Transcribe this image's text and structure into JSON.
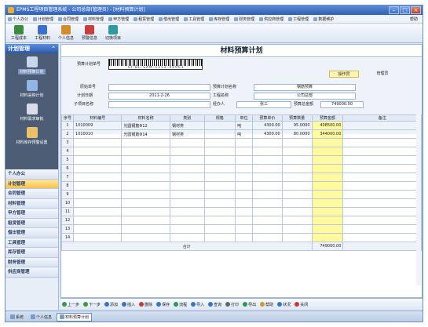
{
  "window": {
    "title": "EPMS工程项目管理系统 - 公司总部(管理员) - [材料预算计划]"
  },
  "menu": [
    "个人办公",
    "计划管理",
    "合同管理",
    "材料管理",
    "甲方管理",
    "租赁管理",
    "借出管理",
    "工具管理",
    "库存管理",
    "财务管理",
    "供应商管理",
    "工程管理",
    "数据维护"
  ],
  "menu_help": "帮助",
  "toolbar": [
    {
      "label": "工程成本",
      "color": "#3f8a3f"
    },
    {
      "label": "工程材料",
      "color": "#3c6fc7"
    },
    {
      "label": "个人信息",
      "color": "#d18d2a"
    },
    {
      "label": "预警信息",
      "color": "#c74040"
    },
    {
      "label": "切换项目",
      "color": "#2f9a9a"
    }
  ],
  "sidebar": {
    "header": "计划管理",
    "icons": [
      {
        "label": "材料预算计划",
        "color": "#c8d6ec"
      },
      {
        "label": "材料采购计划",
        "color": "#8fb6e6"
      },
      {
        "label": "材料需求审批",
        "color": "#d8dce8"
      },
      {
        "label": "材料库存预警设置",
        "color": "#e8c16a"
      }
    ],
    "nav": [
      "个人办公",
      "计划管理",
      "合同管理",
      "材料管理",
      "甲方管理",
      "租赁管理",
      "借出管理",
      "工具管理",
      "库存管理",
      "财务管理",
      "供应商管理"
    ],
    "active_nav": 1
  },
  "page": {
    "title": "材料预算计划"
  },
  "form": {
    "plan_no_label": "预算计划单号",
    "barcode_text": "G I - B L - S A M - 1 1 5 2 - 0 0 0 0 1",
    "operator_label": "操作员",
    "operator_value": "管理员",
    "doc_no_label": "原始单号",
    "plan_name_label": "预算计划名称",
    "plan_name_value": "钢筋预算",
    "date_label": "计划日期",
    "date_value": "2011-2-26",
    "project_label": "工程名称",
    "project_value": "公司总部",
    "subproject_label": "子项目名称",
    "handler_label": "经办人",
    "handler_value": "张三",
    "amount_label": "预算总金额",
    "amount_value": "749000.00"
  },
  "table": {
    "headers": [
      "序号",
      "材料编号",
      "材料名称",
      "类别",
      "规格",
      "单位",
      "预算单价",
      "预算数量",
      "预算金额",
      "备注"
    ],
    "rows": [
      [
        "1",
        "1010009",
        "光圆钢筋Φ12",
        "钢材类",
        "",
        "吨",
        "4300.00",
        "95.0000",
        "408500.00",
        ""
      ],
      [
        "2",
        "1010010",
        "光圆钢筋Φ14",
        "钢材类",
        "",
        "吨",
        "4300.00",
        "80.0000",
        "344000.00",
        ""
      ],
      [
        "3",
        "",
        "",
        "",
        "",
        "",
        "",
        "",
        "",
        ""
      ],
      [
        "4",
        "",
        "",
        "",
        "",
        "",
        "",
        "",
        "",
        ""
      ],
      [
        "5",
        "",
        "",
        "",
        "",
        "",
        "",
        "",
        "",
        ""
      ],
      [
        "6",
        "",
        "",
        "",
        "",
        "",
        "",
        "",
        "",
        ""
      ],
      [
        "7",
        "",
        "",
        "",
        "",
        "",
        "",
        "",
        "",
        ""
      ],
      [
        "8",
        "",
        "",
        "",
        "",
        "",
        "",
        "",
        "",
        ""
      ],
      [
        "9",
        "",
        "",
        "",
        "",
        "",
        "",
        "",
        "",
        ""
      ],
      [
        "10",
        "",
        "",
        "",
        "",
        "",
        "",
        "",
        "",
        ""
      ],
      [
        "11",
        "",
        "",
        "",
        "",
        "",
        "",
        "",
        "",
        ""
      ],
      [
        "12",
        "",
        "",
        "",
        "",
        "",
        "",
        "",
        "",
        ""
      ],
      [
        "13",
        "",
        "",
        "",
        "",
        "",
        "",
        "",
        "",
        ""
      ],
      [
        "14",
        "",
        "",
        "",
        "",
        "",
        "",
        "",
        "",
        ""
      ]
    ],
    "total_label": "合计",
    "total_value": "749000.00"
  },
  "actions": [
    {
      "label": "上一步",
      "color": "#3c9a3c"
    },
    {
      "label": "下一步",
      "color": "#3c9a3c"
    },
    {
      "label": "添加",
      "color": "#3b73c9"
    },
    {
      "label": "插入",
      "color": "#3b73c9"
    },
    {
      "label": "删除",
      "color": "#c63b2f"
    },
    {
      "label": "保存",
      "color": "#3b73c9"
    },
    {
      "label": "流程",
      "color": "#2f9a4a"
    },
    {
      "label": "导入",
      "color": "#3b73c9"
    },
    {
      "label": "查询",
      "color": "#3b73c9"
    },
    {
      "label": "打印",
      "color": "#666"
    },
    {
      "label": "导出",
      "color": "#2f9a4a"
    },
    {
      "label": "帮助",
      "color": "#d39a2a"
    },
    {
      "label": "状况",
      "color": "#3b73c9"
    },
    {
      "label": "关闭",
      "color": "#c63b2f"
    }
  ],
  "status": {
    "items": [
      {
        "label": "系统"
      },
      {
        "label": "个人信息"
      },
      {
        "label": "材料预算计划"
      }
    ],
    "active": 2
  }
}
